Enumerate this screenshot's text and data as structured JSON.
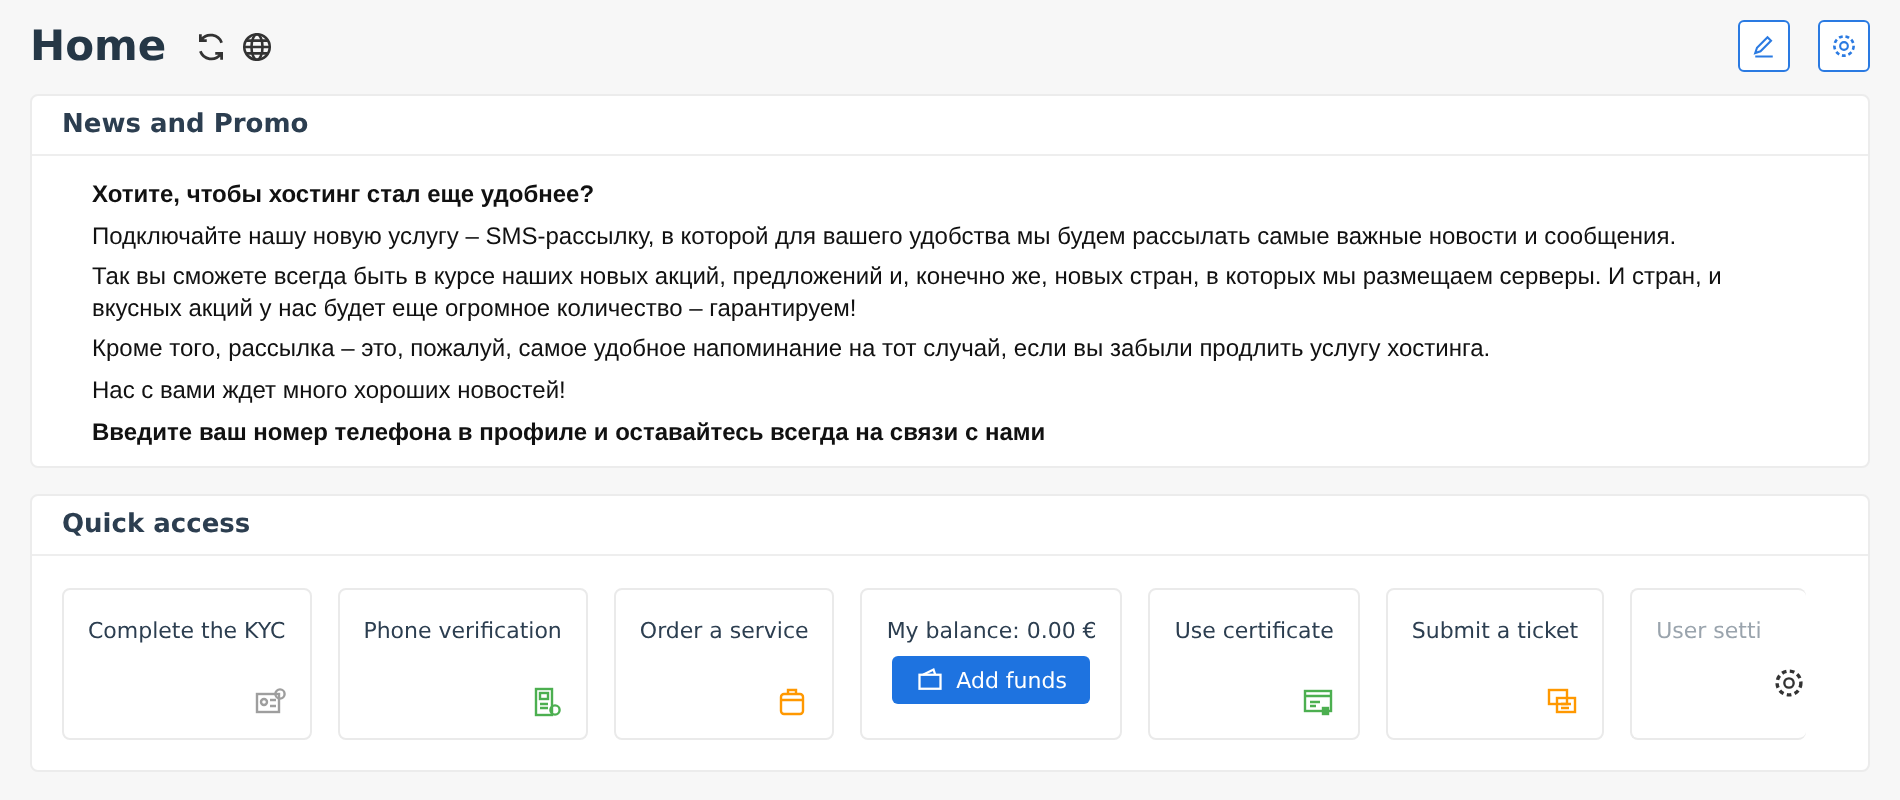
{
  "page": {
    "title": "Home"
  },
  "news": {
    "title": "News and Promo",
    "paragraphs": [
      {
        "kind": "heading",
        "text": "Хотите, чтобы хостинг стал еще удобнее?"
      },
      {
        "kind": "text",
        "text": "Подключайте нашу новую услугу – SMS-рассылку, в которой для вашего удобства мы будем рассылать самые важные новости и сообщения."
      },
      {
        "kind": "text",
        "text": "Так вы сможете всегда быть в курсе наших новых акций, предложений и, конечно же, новых стран, в которых мы размещаем серверы. И стран, и вкусных акций у нас будет еще огромное количество – гарантируем!"
      },
      {
        "kind": "text",
        "text": "Кроме того, рассылка – это, пожалуй, самое удобное напоминание на тот случай, если вы забыли продлить услугу хостинга."
      },
      {
        "kind": "text",
        "text": "Нас с вами ждет много хороших новостей!"
      },
      {
        "kind": "heading",
        "text": "Введите ваш номер телефона в профиле и оставайтесь всегда на связи с нами"
      }
    ]
  },
  "quick_access": {
    "title": "Quick access",
    "items": [
      {
        "kind": "kyc",
        "label": "Complete the KYC",
        "color": "#9e9e9e"
      },
      {
        "kind": "phone",
        "label": "Phone verification",
        "color": "#4caf50"
      },
      {
        "kind": "order",
        "label": "Order a service",
        "color": "#ff9800"
      },
      {
        "kind": "balance",
        "label": "My balance: 0.00 €",
        "button": "Add funds"
      },
      {
        "kind": "certificate",
        "label": "Use certificate",
        "color": "#4caf50"
      },
      {
        "kind": "ticket",
        "label": "Submit a ticket",
        "color": "#ff9800"
      },
      {
        "kind": "faded",
        "label": "User setti"
      }
    ]
  }
}
